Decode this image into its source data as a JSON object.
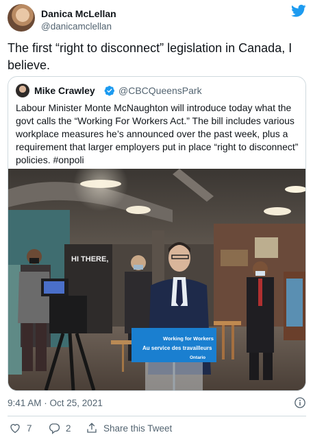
{
  "author": {
    "name": "Danica McLellan",
    "handle": "@danicamclellan"
  },
  "tweet_text": "The first “right to disconnect” legislation in Canada, I believe.",
  "quoted": {
    "name": "Mike Crawley",
    "handle": "@CBCQueensPark",
    "text": "Labour Minister Monte McNaughton will introduce today what the govt calls the “Working For Workers Act.”  The bill includes various workplace measures he’s announced over the past week, plus a requirement that larger employers put in place “right to disconnect” policies. #onpoli",
    "photo": {
      "podium_line1": "Working for Workers",
      "podium_line2": "Au service des travailleurs",
      "podium_logo": "Ontario",
      "banner_text": "HI THERE,"
    }
  },
  "timestamp": "9:41 AM · Oct 25, 2021",
  "actions": {
    "likes": "7",
    "replies": "2",
    "share_label": "Share this Tweet"
  },
  "colors": {
    "twitter_blue": "#1d9bf0",
    "text": "#0f1419",
    "muted": "#536471",
    "border": "#cfd9de",
    "podium_blue": "#1a7fd0"
  }
}
